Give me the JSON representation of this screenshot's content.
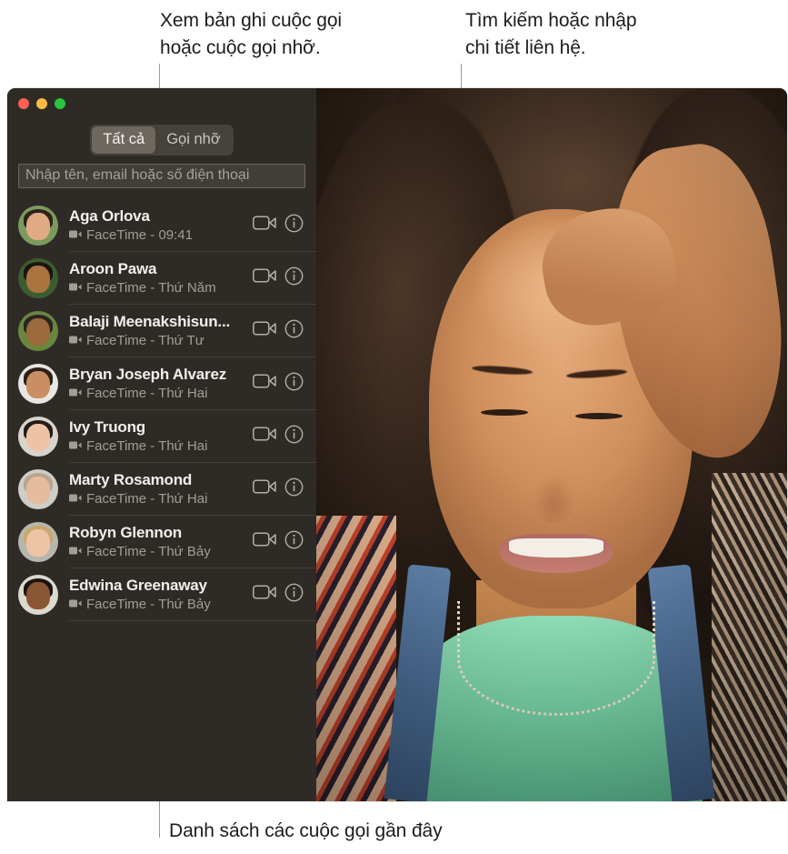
{
  "callouts": {
    "tabs": "Xem bản ghi cuộc gọi\nhoặc cuộc gọi nhỡ.",
    "search": "Tìm kiếm hoặc nhập\nchi tiết liên hệ.",
    "recents": "Danh sách các cuộc gọi gần đây"
  },
  "window": {
    "traffic_lights": [
      {
        "name": "close",
        "color": "#ff5f57"
      },
      {
        "name": "minimize",
        "color": "#fdbc40"
      },
      {
        "name": "zoom",
        "color": "#28c840"
      }
    ]
  },
  "segmented": {
    "options": [
      {
        "label": "Tất cả",
        "selected": true
      },
      {
        "label": "Gọi nhỡ",
        "selected": false
      }
    ]
  },
  "search": {
    "value": "",
    "placeholder": "Nhập tên, email hoặc số điện thoại"
  },
  "calls": [
    {
      "name": "Aga Orlova",
      "detail": "FaceTime - 09:41",
      "hair": "#2d2218",
      "skin": "#e0ab83",
      "bg": "#7c9a5e"
    },
    {
      "name": "Aroon Pawa",
      "detail": "FaceTime - Thứ Năm",
      "hair": "#1a1410",
      "skin": "#a9743f",
      "bg": "#3d5c30"
    },
    {
      "name": "Balaji Meenakshisun...",
      "detail": "FaceTime - Thứ Tư",
      "hair": "#2a2422",
      "skin": "#9c6a3c",
      "bg": "#69863f"
    },
    {
      "name": "Bryan Joseph Alvarez",
      "detail": "FaceTime - Thứ Hai",
      "hair": "#2e1f16",
      "skin": "#c98f63",
      "bg": "#e8e6e2"
    },
    {
      "name": "Ivy Truong",
      "detail": "FaceTime - Thứ Hai",
      "hair": "#241c16",
      "skin": "#edc3a4",
      "bg": "#d8d4cd"
    },
    {
      "name": "Marty Rosamond",
      "detail": "FaceTime - Thứ Hai",
      "hair": "#b9a590",
      "skin": "#e6bd9c",
      "bg": "#cfcdc8"
    },
    {
      "name": "Robyn Glennon",
      "detail": "FaceTime - Thứ Bảy",
      "hair": "#c8a86e",
      "skin": "#edc4a6",
      "bg": "#b5b7ad"
    },
    {
      "name": "Edwina Greenaway",
      "detail": "FaceTime - Thứ Bảy",
      "hair": "#1b1512",
      "skin": "#8a5634",
      "bg": "#dcd9d0"
    }
  ],
  "row_actions": {
    "video_call": "video-call-button",
    "info": "info-button"
  },
  "icons": {
    "mini_camera": "camera-icon",
    "video_camera": "video-camera-icon",
    "info_circle": "info-circle-icon"
  },
  "colors": {
    "window_bg": "#2e2b26",
    "segment_track": "#46423c",
    "segment_selected": "#6d675f",
    "separator": "#413d37",
    "name_text": "#f2f0ed",
    "detail_text": "#a29d96",
    "leader_line": "#9a9a9a"
  }
}
